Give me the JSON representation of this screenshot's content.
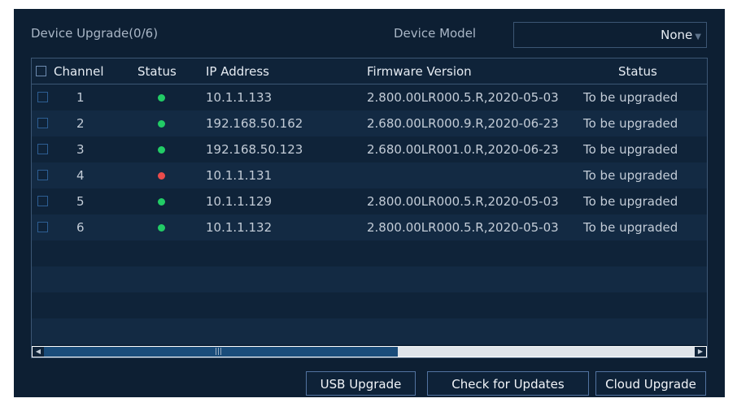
{
  "header": {
    "title": "Device Upgrade(0/6)",
    "model_label": "Device Model",
    "model_value": "None"
  },
  "table": {
    "columns": [
      "Channel",
      "Status",
      "IP Address",
      "Firmware Version",
      "Status"
    ],
    "rows": [
      {
        "channel": "1",
        "status": "online",
        "ip": "10.1.1.133",
        "firmware": "2.800.00LR000.5.R,2020-05-03",
        "upgrade_status": "To be upgraded"
      },
      {
        "channel": "2",
        "status": "online",
        "ip": "192.168.50.162",
        "firmware": "2.680.00LR000.9.R,2020-06-23",
        "upgrade_status": "To be upgraded"
      },
      {
        "channel": "3",
        "status": "online",
        "ip": "192.168.50.123",
        "firmware": "2.680.00LR001.0.R,2020-06-23",
        "upgrade_status": "To be upgraded"
      },
      {
        "channel": "4",
        "status": "offline",
        "ip": "10.1.1.131",
        "firmware": "",
        "upgrade_status": "To be upgraded"
      },
      {
        "channel": "5",
        "status": "online",
        "ip": "10.1.1.129",
        "firmware": "2.800.00LR000.5.R,2020-05-03",
        "upgrade_status": "To be upgraded"
      },
      {
        "channel": "6",
        "status": "online",
        "ip": "10.1.1.132",
        "firmware": "2.800.00LR000.5.R,2020-05-03",
        "upgrade_status": "To be upgraded"
      }
    ]
  },
  "status_colors": {
    "online": "#22cc66",
    "offline": "#e94b4b"
  },
  "icons": {
    "scroll_left": "arrow-left-icon",
    "scroll_right": "arrow-right-icon",
    "dropdown": "caret-down-icon"
  },
  "buttons": {
    "usb_upgrade": "USB Upgrade",
    "check_updates": "Check for Updates",
    "cloud_upgrade": "Cloud Upgrade"
  }
}
